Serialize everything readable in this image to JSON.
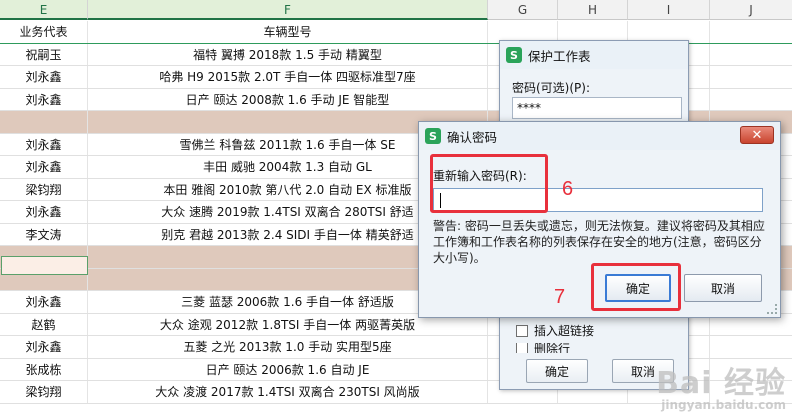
{
  "columns": [
    "E",
    "F",
    "G",
    "H",
    "I",
    "J"
  ],
  "table": {
    "header": [
      "业务代表",
      "车辆型号"
    ],
    "rows": [
      [
        "祝嗣玉",
        "福特 翼搏 2018款  1.5 手动 精翼型"
      ],
      [
        "刘永鑫",
        "哈弗 H9 2015款  2.0T 手自一体 四驱标准型7座"
      ],
      [
        "刘永鑫",
        "日产 颐达 2008款  1.6 手动 JE 智能型"
      ],
      [
        "",
        ""
      ],
      [
        "刘永鑫",
        "雪佛兰 科鲁兹 2011款  1.6 手自一体 SE"
      ],
      [
        "刘永鑫",
        "丰田 威驰 2004款  1.3 自动 GL"
      ],
      [
        "梁钧翔",
        "本田 雅阁 2010款 第八代 2.0 自动 EX 标准版"
      ],
      [
        "刘永鑫",
        "大众 速腾 2019款  1.4TSI 双离合 280TSI 舒适"
      ],
      [
        "李文涛",
        "别克 君越 2013款  2.4 SIDI 手自一体 精英舒适"
      ],
      [
        "",
        ""
      ],
      [
        "",
        ""
      ],
      [
        "刘永鑫",
        "三菱 蓝瑟 2006款  1.6 手自一体 舒适版"
      ],
      [
        "赵鹤",
        "大众 途观 2012款  1.8TSI 手自一体 两驱菁英版"
      ],
      [
        "刘永鑫",
        "五菱 之光 2013款  1.0 手动 实用型5座"
      ],
      [
        "张成栋",
        "日产 颐达 2006款  1.6 自动 JE"
      ],
      [
        "梁钧翔",
        "大众 凌渡 2017款  1.4TSI 双离合 230TSI 风尚版"
      ]
    ]
  },
  "protect_dialog": {
    "title": "保护工作表",
    "password_label": "密码(可选)(P):",
    "password_value": "****",
    "checkbox_label": "插入超链接",
    "checkbox_label_partial": "删除行",
    "ok_label": "确定",
    "cancel_label": "取消"
  },
  "confirm_dialog": {
    "title": "确认密码",
    "close_symbol": "✕",
    "reenter_label": "重新输入密码(R):",
    "warning": "警告: 密码一旦丢失或遗忘，则无法恢复。建议将密码及其相应工作簿和工作表名称的列表保存在安全的地方(注意，密码区分大小写)。",
    "ok_label": "确定",
    "cancel_label": "取消"
  },
  "annotations": {
    "step6": "6",
    "step7": "7"
  },
  "watermark": {
    "text": "Bai 经验",
    "sub": "jingyan.baidu.com"
  },
  "colors": {
    "accent_green": "#2aa35a",
    "annotation_red": "#e8303c",
    "blank_row": "#dfc9bc"
  }
}
